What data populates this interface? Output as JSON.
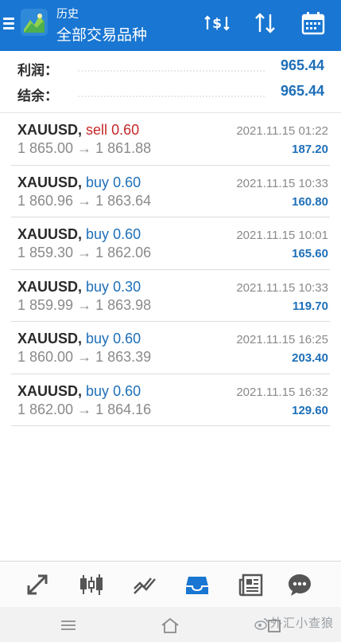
{
  "header": {
    "subtitle": "历史",
    "title": "全部交易品种",
    "bg_color": "#1976d2"
  },
  "summary": {
    "profit_label": "利润：",
    "profit_value": "965.44",
    "balance_label": "结余：",
    "balance_value": "965.44"
  },
  "trades": [
    {
      "symbol": "XAUUSD,",
      "type": "sell",
      "volume": "0.60",
      "open": "1 865.00",
      "arrow": "→",
      "close": "1 861.88",
      "time": "2021.11.15 01:22",
      "profit": "187.20"
    },
    {
      "symbol": "XAUUSD,",
      "type": "buy",
      "volume": "0.60",
      "open": "1 860.96",
      "arrow": "→",
      "close": "1 863.64",
      "time": "2021.11.15 10:33",
      "profit": "160.80"
    },
    {
      "symbol": "XAUUSD,",
      "type": "buy",
      "volume": "0.60",
      "open": "1 859.30",
      "arrow": "→",
      "close": "1 862.06",
      "time": "2021.11.15 10:01",
      "profit": "165.60"
    },
    {
      "symbol": "XAUUSD,",
      "type": "buy",
      "volume": "0.30",
      "open": "1 859.99",
      "arrow": "→",
      "close": "1 863.98",
      "time": "2021.11.15 10:33",
      "profit": "119.70"
    },
    {
      "symbol": "XAUUSD,",
      "type": "buy",
      "volume": "0.60",
      "open": "1 860.00",
      "arrow": "→",
      "close": "1 863.39",
      "time": "2021.11.15 16:25",
      "profit": "203.40"
    },
    {
      "symbol": "XAUUSD,",
      "type": "buy",
      "volume": "0.60",
      "open": "1 862.00",
      "arrow": "→",
      "close": "1 864.16",
      "time": "2021.11.15 16:32",
      "profit": "129.60"
    }
  ],
  "colors": {
    "sell": "#c62828",
    "buy": "#1e6fb8",
    "profit": "#1e6fb8",
    "nav_active": "#1976d2",
    "nav_inactive": "#555555"
  },
  "bottom_nav": {
    "items": [
      "quotes-icon",
      "chart-candles-icon",
      "trade-icon",
      "history-inbox-icon",
      "news-icon",
      "chat-icon"
    ],
    "active": "history-inbox-icon"
  },
  "watermark": "外汇小查狼"
}
